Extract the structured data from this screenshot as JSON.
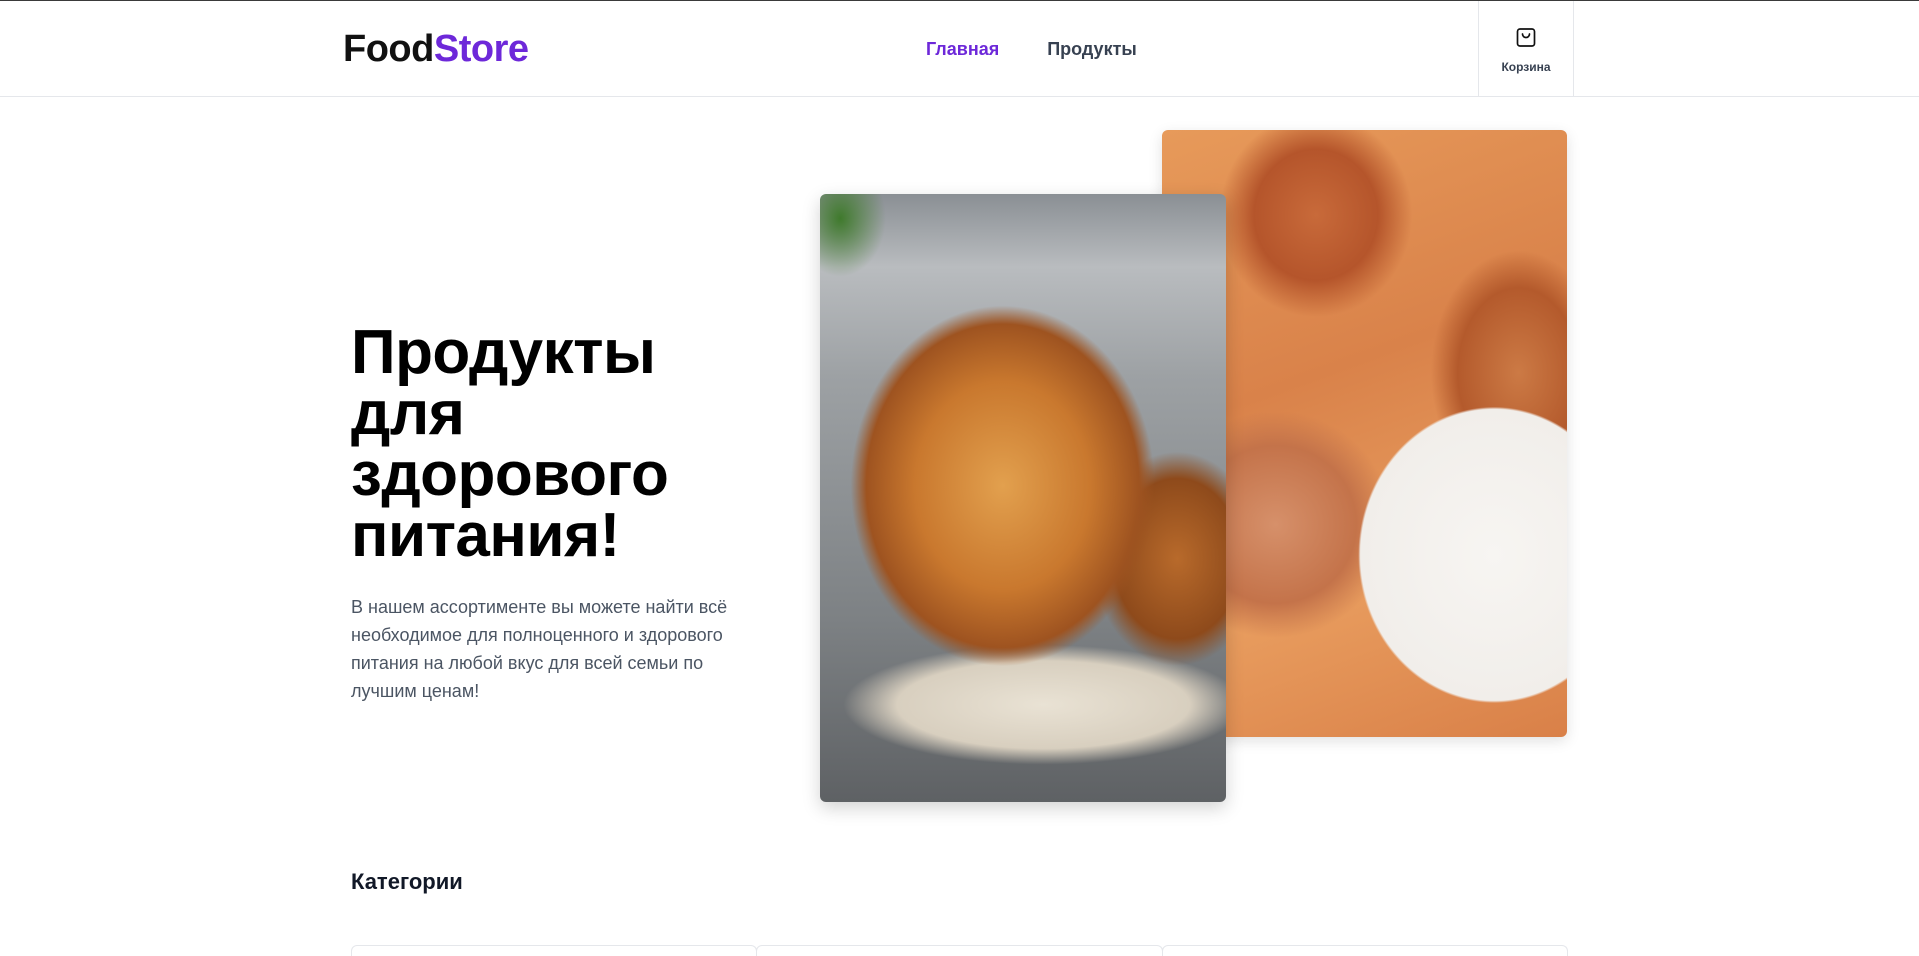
{
  "brand": {
    "part1": "Food",
    "part2": "Store",
    "accent_color": "#6d28d9"
  },
  "nav": {
    "items": [
      {
        "label": "Главная",
        "active": true
      },
      {
        "label": "Продукты",
        "active": false
      }
    ]
  },
  "cart": {
    "icon": "shopping-bag-icon",
    "label": "Корзина"
  },
  "hero": {
    "title": "Продукты для здорового питания!",
    "text": "В нашем ассортименте вы можете найти всё необходимое для полноценного и здорового питания на любой вкус для всей семьи по лучшим ценам!"
  },
  "categories": {
    "title": "Категории"
  }
}
